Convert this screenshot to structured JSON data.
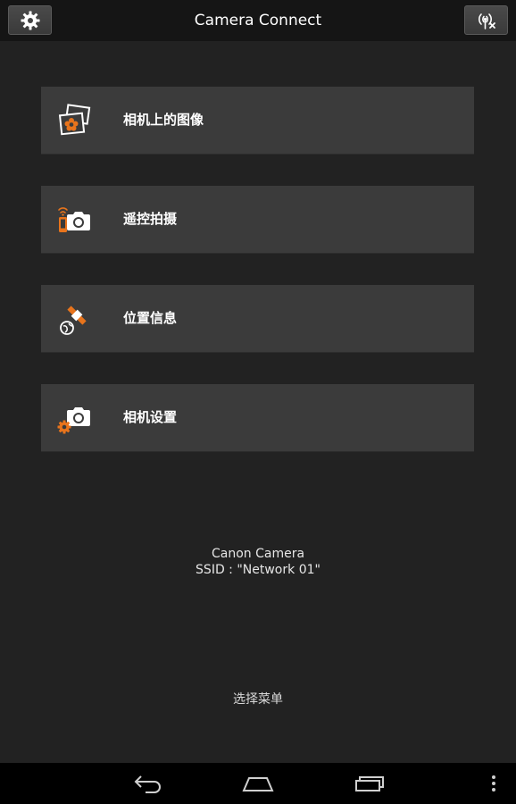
{
  "app": {
    "title": "Camera Connect"
  },
  "topbar": {
    "settings_icon": "gear-icon",
    "wireless_icon": "wireless-off-icon"
  },
  "menu": {
    "items": [
      {
        "label": "相机上的图像",
        "icon": "camera-images-icon"
      },
      {
        "label": "遥控拍摄",
        "icon": "remote-shooting-icon"
      },
      {
        "label": "位置信息",
        "icon": "location-info-icon"
      },
      {
        "label": "相机设置",
        "icon": "camera-settings-icon"
      }
    ]
  },
  "connection": {
    "camera_name": "Canon Camera",
    "ssid": "SSID : \"Network 01\""
  },
  "hint": "选择菜单",
  "navbar": {
    "icons": [
      "back-icon",
      "home-icon",
      "recents-icon",
      "overflow-menu-icon"
    ]
  },
  "colors": {
    "accent": "#e8741c",
    "background": "#222222",
    "item_bg": "#3b3b3b"
  }
}
